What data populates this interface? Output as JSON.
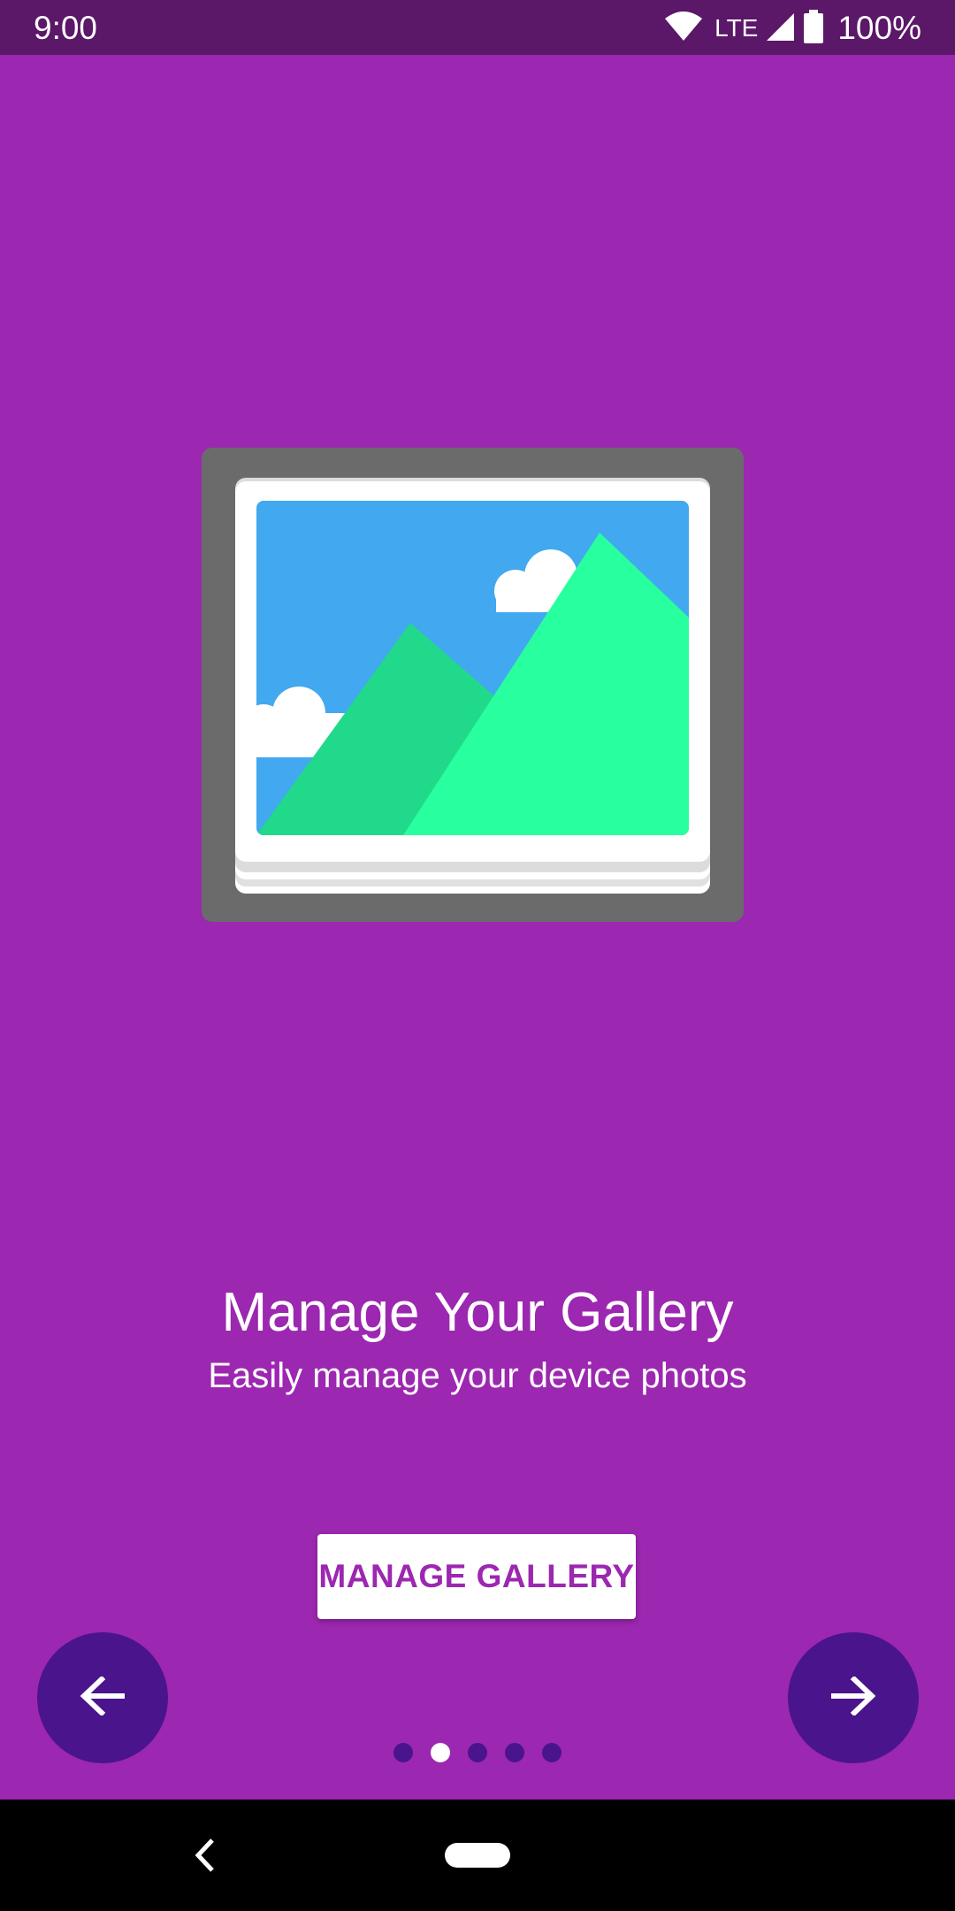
{
  "status_bar": {
    "time": "9:00",
    "network": "LTE",
    "battery": "100%",
    "icons": [
      "wifi-icon",
      "cell-signal-icon",
      "battery-icon"
    ]
  },
  "slide": {
    "title": "Manage Your Gallery",
    "subtitle": "Easily manage your device photos",
    "illustration": "gallery-photo-icon",
    "button_label": "MANAGE GALLERY"
  },
  "navigation": {
    "prev_icon": "arrow-left-icon",
    "next_icon": "arrow-right-icon",
    "page_count": 5,
    "current_page": 2
  },
  "system_nav": {
    "back_icon": "back-chevron-icon",
    "home_icon": "home-pill-icon"
  },
  "colors": {
    "background": "#9c27b0",
    "status_bar": "#5b1768",
    "fab": "#4a148c",
    "sky": "#42a8f0",
    "mountain_dark": "#21d98a",
    "mountain_light": "#28ff9e",
    "frame": "#6b6b6b"
  }
}
